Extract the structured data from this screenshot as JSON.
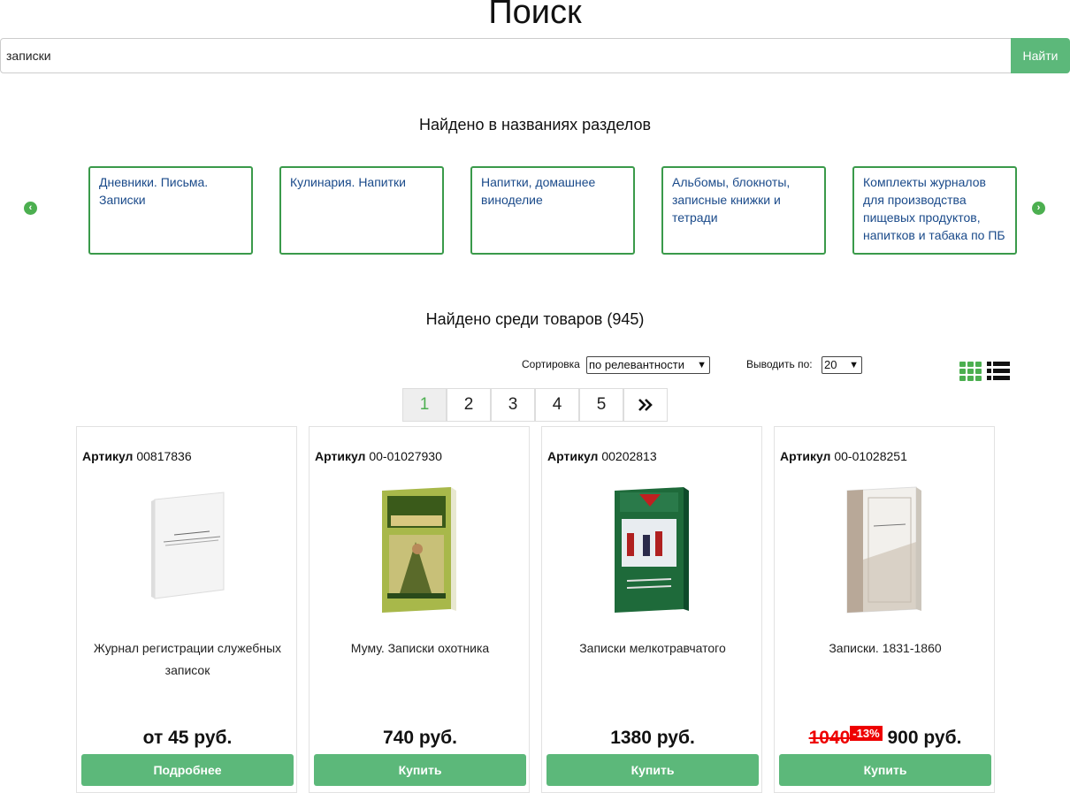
{
  "title": "Поиск",
  "search": {
    "value": "записки",
    "button_label": "Найти"
  },
  "categories_section": {
    "heading": "Найдено в названиях разделов",
    "items": [
      {
        "label": "Дневники. Письма. Записки"
      },
      {
        "label": "Кулинария. Напитки"
      },
      {
        "label": "Напитки, домашнее виноделие"
      },
      {
        "label": "Альбомы, блокноты, записные книжки и тетради"
      },
      {
        "label": "Комплекты журналов для производства пищевых продуктов, напитков и табака по ПБ"
      }
    ],
    "prev_icon": "chevron-left-icon",
    "next_icon": "chevron-right-icon"
  },
  "products_section": {
    "heading": "Найдено среди товаров (945)",
    "sort_label": "Сортировка",
    "sort_value": "по релевантности",
    "perpage_label": "Выводить по:",
    "perpage_value": "20",
    "view_icons": [
      "grid-view-icon",
      "list-view-icon"
    ]
  },
  "pagination": {
    "pages": [
      "1",
      "2",
      "3",
      "4",
      "5"
    ],
    "current": "1",
    "next_icon": "double-chevron-right-icon"
  },
  "products": [
    {
      "sku_label": "Артикул",
      "sku": "00817836",
      "name": "Журнал регистрации служебных записок",
      "price": "от 45 руб.",
      "button": "Подробнее"
    },
    {
      "sku_label": "Артикул",
      "sku": "00-01027930",
      "name": "Муму. Записки охотника",
      "price": "740 руб.",
      "button": "Купить"
    },
    {
      "sku_label": "Артикул",
      "sku": "00202813",
      "name": "Записки мелкотравчатого",
      "price": "1380 руб.",
      "button": "Купить"
    },
    {
      "sku_label": "Артикул",
      "sku": "00-01028251",
      "name": "Записки. 1831-1860",
      "old_price": "1040",
      "discount": "-13%",
      "price": "900 руб.",
      "button": "Купить"
    }
  ],
  "colors": {
    "accent": "#5cb87a",
    "border_green": "#3a9a4a",
    "link": "#1a4a8a",
    "discount": "#e00000"
  }
}
